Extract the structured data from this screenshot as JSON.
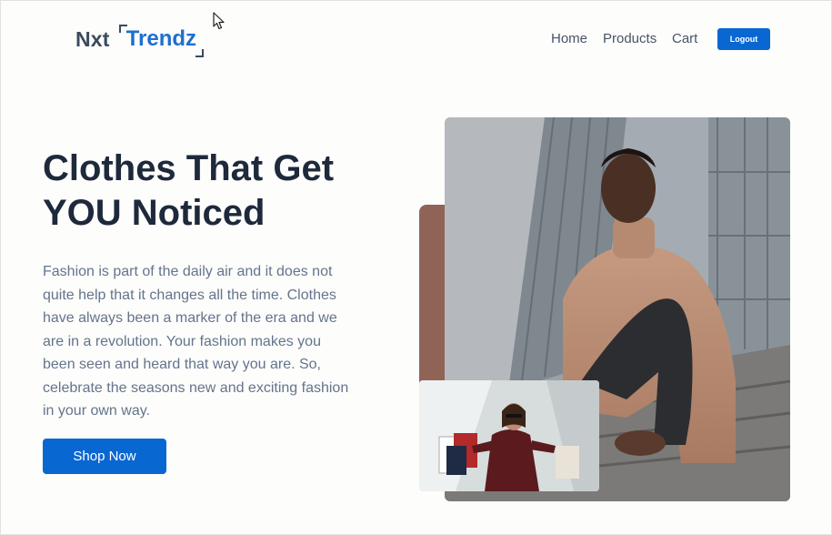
{
  "navbar": {
    "logo_prefix": "Nxt",
    "logo_brand": "Trendz",
    "links": [
      {
        "label": "Home"
      },
      {
        "label": "Products"
      },
      {
        "label": "Cart"
      }
    ],
    "logout_label": "Logout"
  },
  "hero": {
    "heading_line1": "Clothes That Get",
    "heading_line2": "YOU Noticed",
    "description": "Fashion is part of the daily air and it does not quite help that it changes all the time. Clothes have always been a marker of the era and we are in a revolution. Your fashion makes you been seen and heard that way you are. So, celebrate the seasons new and exciting fashion in your own way.",
    "cta_label": "Shop Now"
  },
  "colors": {
    "primary": "#0967d2",
    "heading": "#1e293b",
    "body_text": "#64748b",
    "accent_block": "#8f6457"
  },
  "icons": {
    "cursor": "mouse-pointer-icon"
  }
}
